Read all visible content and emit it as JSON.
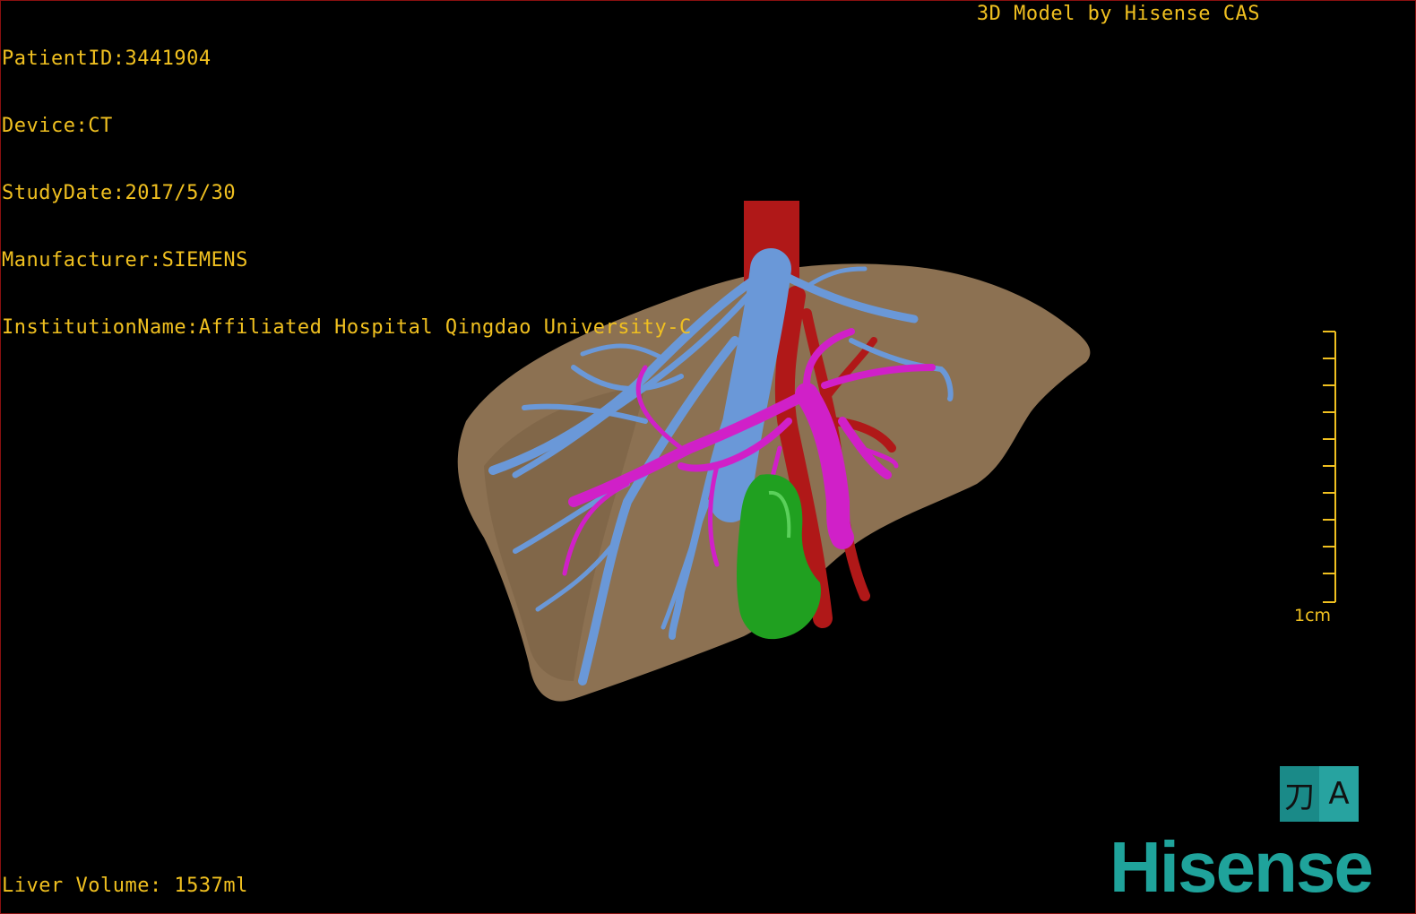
{
  "overlay": {
    "patient_id": "PatientID:3441904",
    "device": "Device:CT",
    "study_date": "StudyDate:2017/5/30",
    "manufacturer": "Manufacturer:SIEMENS",
    "institution": "InstitutionName:Affiliated Hospital Qingdao University-C",
    "credit": "3D Model by Hisense CAS",
    "liver_volume": "Liver Volume: 1537ml"
  },
  "scale_bar": {
    "label": "1cm"
  },
  "view_toggle": {
    "left_glyph": "⼑",
    "right_glyph": "A"
  },
  "brand": {
    "logo_text": "Hisense"
  },
  "colors": {
    "text": "#f0c020",
    "liver": "#8c7152",
    "hepatic_vein": "#6a98d8",
    "portal_vein": "#d020c8",
    "artery_ivc": "#b01818",
    "lesion": "#20a020",
    "brand": "#1fa39b"
  }
}
